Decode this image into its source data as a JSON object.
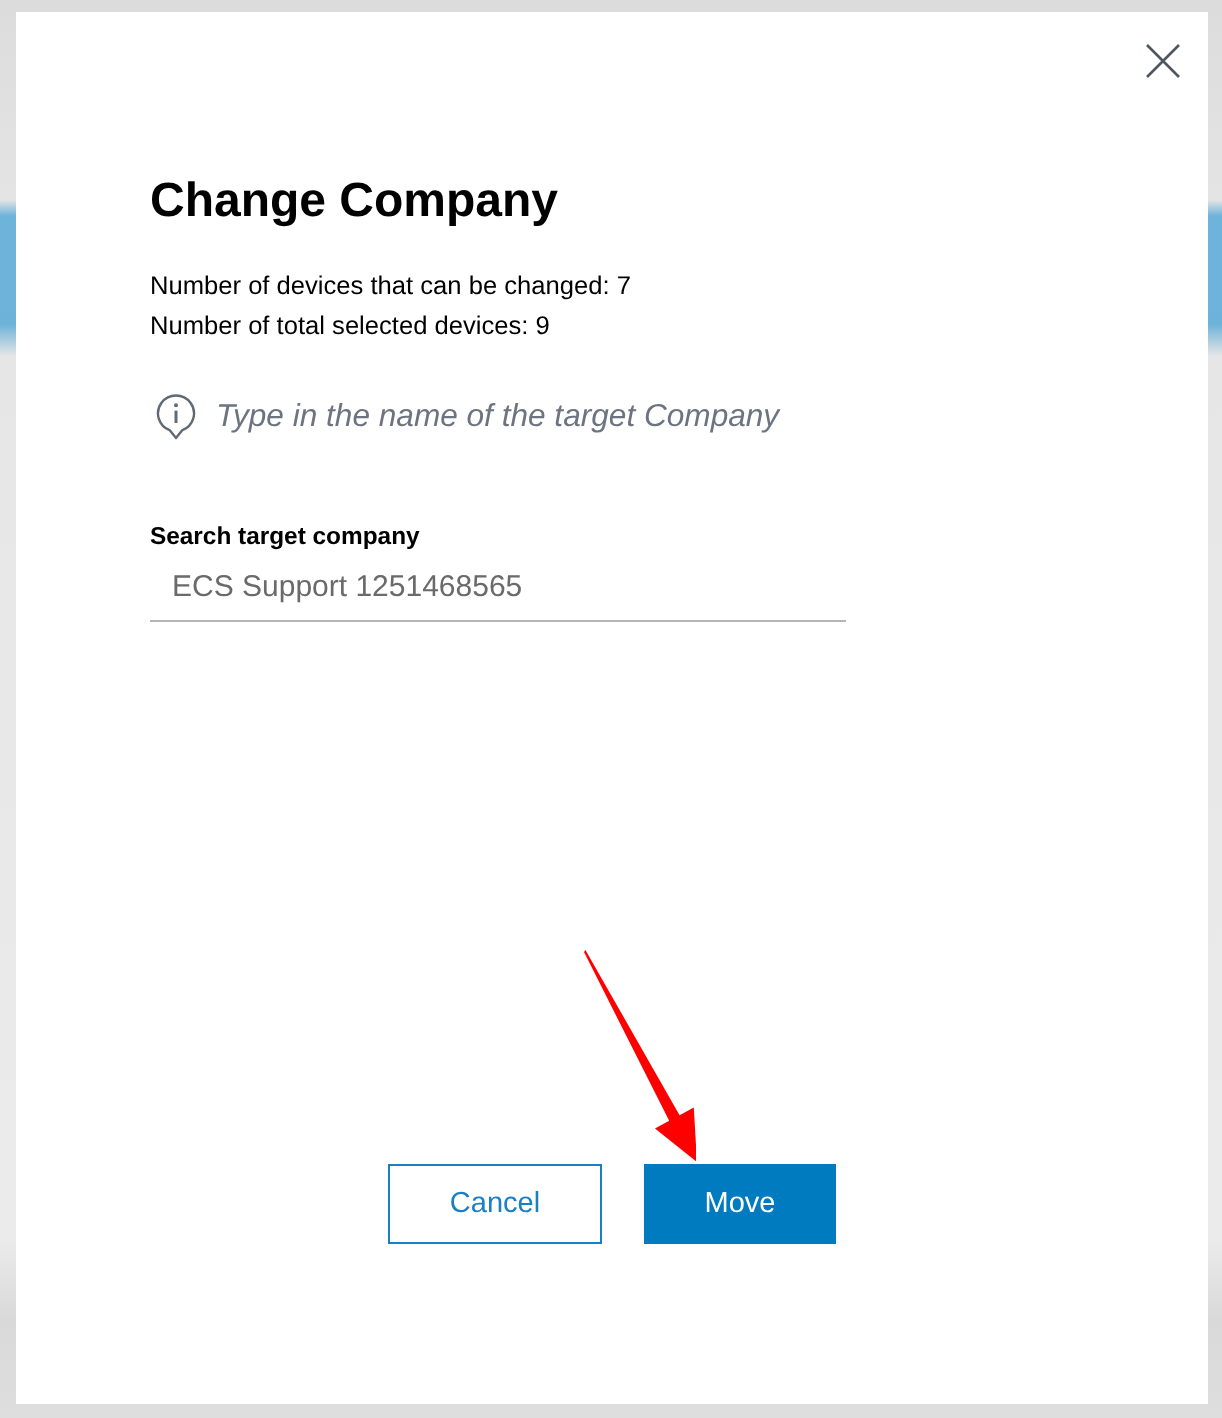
{
  "dialog": {
    "title": "Change Company",
    "info_lines": [
      "Number of devices that can be changed: 7",
      "Number of total selected devices: 9"
    ],
    "hint": "Type in the name of the target Company",
    "search_field": {
      "label": "Search target company",
      "value": "ECS Support 1251468565"
    },
    "buttons": [
      {
        "label": "Cancel",
        "kind": "secondary"
      },
      {
        "label": "Move",
        "kind": "primary"
      }
    ]
  }
}
